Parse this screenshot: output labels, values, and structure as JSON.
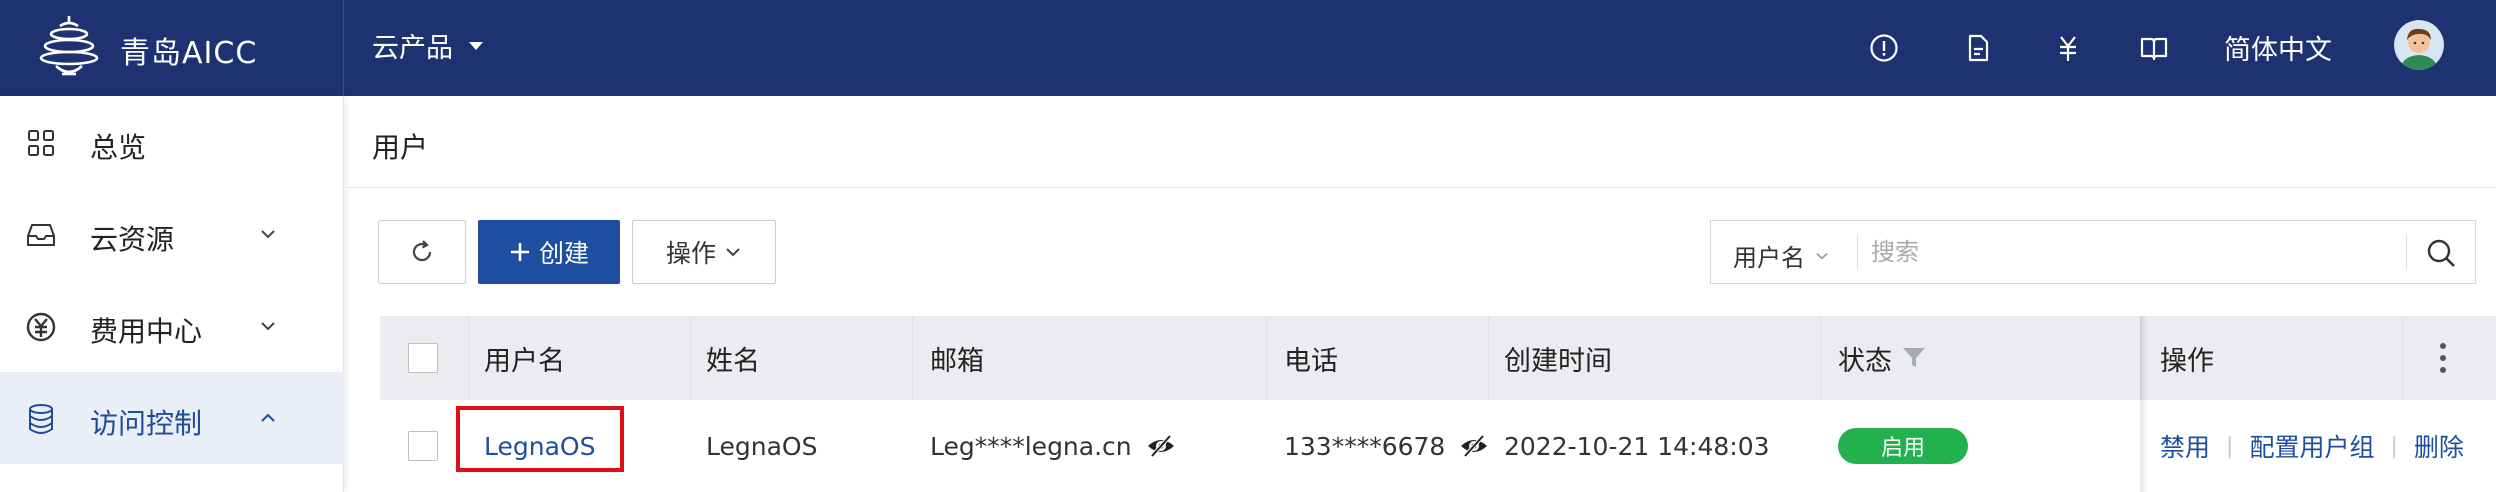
{
  "topbar": {
    "brand_name": "青岛AICC",
    "product_menu": "云产品",
    "icons": [
      "alert-icon",
      "document-icon",
      "yuan-icon",
      "book-icon"
    ],
    "language": "简体中文"
  },
  "sidebar": {
    "items": [
      {
        "label": "总览",
        "icon": "grid-icon",
        "expandable": false
      },
      {
        "label": "云资源",
        "icon": "inbox-icon",
        "expandable": true
      },
      {
        "label": "费用中心",
        "icon": "yen-circle-icon",
        "expandable": true
      },
      {
        "label": "访问控制",
        "icon": "database-icon",
        "expandable": true,
        "expanded": true,
        "active": true
      }
    ]
  },
  "main": {
    "title": "用户",
    "toolbar": {
      "create_label": "创建",
      "actions_label": "操作"
    },
    "search": {
      "field": "用户名",
      "placeholder": "搜索"
    },
    "table": {
      "columns": [
        "用户名",
        "姓名",
        "邮箱",
        "电话",
        "创建时间",
        "状态",
        "操作"
      ],
      "rows": [
        {
          "username": "LegnaOS",
          "name": "LegnaOS",
          "email": "Leg****legna.cn",
          "phone": "133****6678",
          "created": "2022-10-21 14:48:03",
          "status": "启用",
          "actions": [
            "禁用",
            "配置用户组",
            "删除"
          ]
        }
      ]
    }
  },
  "colors": {
    "topbar_bg": "#1e3272",
    "primary": "#1d4ea0",
    "status_enabled": "#22b14c",
    "highlight": "#e0101a"
  }
}
